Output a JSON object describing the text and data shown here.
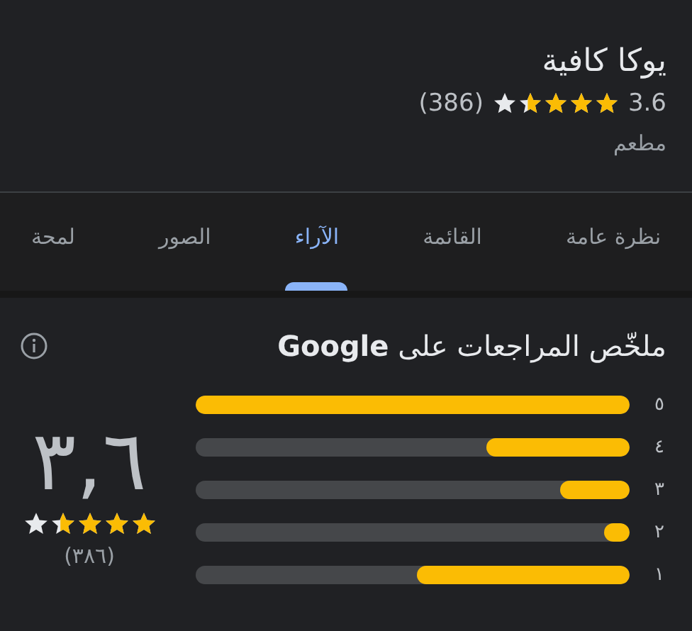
{
  "place": {
    "name": "يوكا كافية",
    "rating": "3.6",
    "stars": 3.6,
    "review_count": "(386)",
    "category": "مطعم"
  },
  "tabs": [
    {
      "label": "نظرة عامة",
      "selected": false
    },
    {
      "label": "القائمة",
      "selected": false
    },
    {
      "label": "الآراء",
      "selected": true
    },
    {
      "label": "الصور",
      "selected": false
    },
    {
      "label": "لمحة",
      "selected": false
    }
  ],
  "summary": {
    "title": "ملخّص المراجعات على **Google**",
    "score": "٣,٦",
    "stars": 3.6,
    "count": "(٣٨٦)",
    "bars": [
      {
        "label": "٥",
        "level": 1.0
      },
      {
        "label": "٤",
        "level": 0.33
      },
      {
        "label": "٣",
        "level": 0.16
      },
      {
        "label": "٢",
        "level": 0.06
      },
      {
        "label": "١",
        "level": 0.49
      }
    ]
  }
}
